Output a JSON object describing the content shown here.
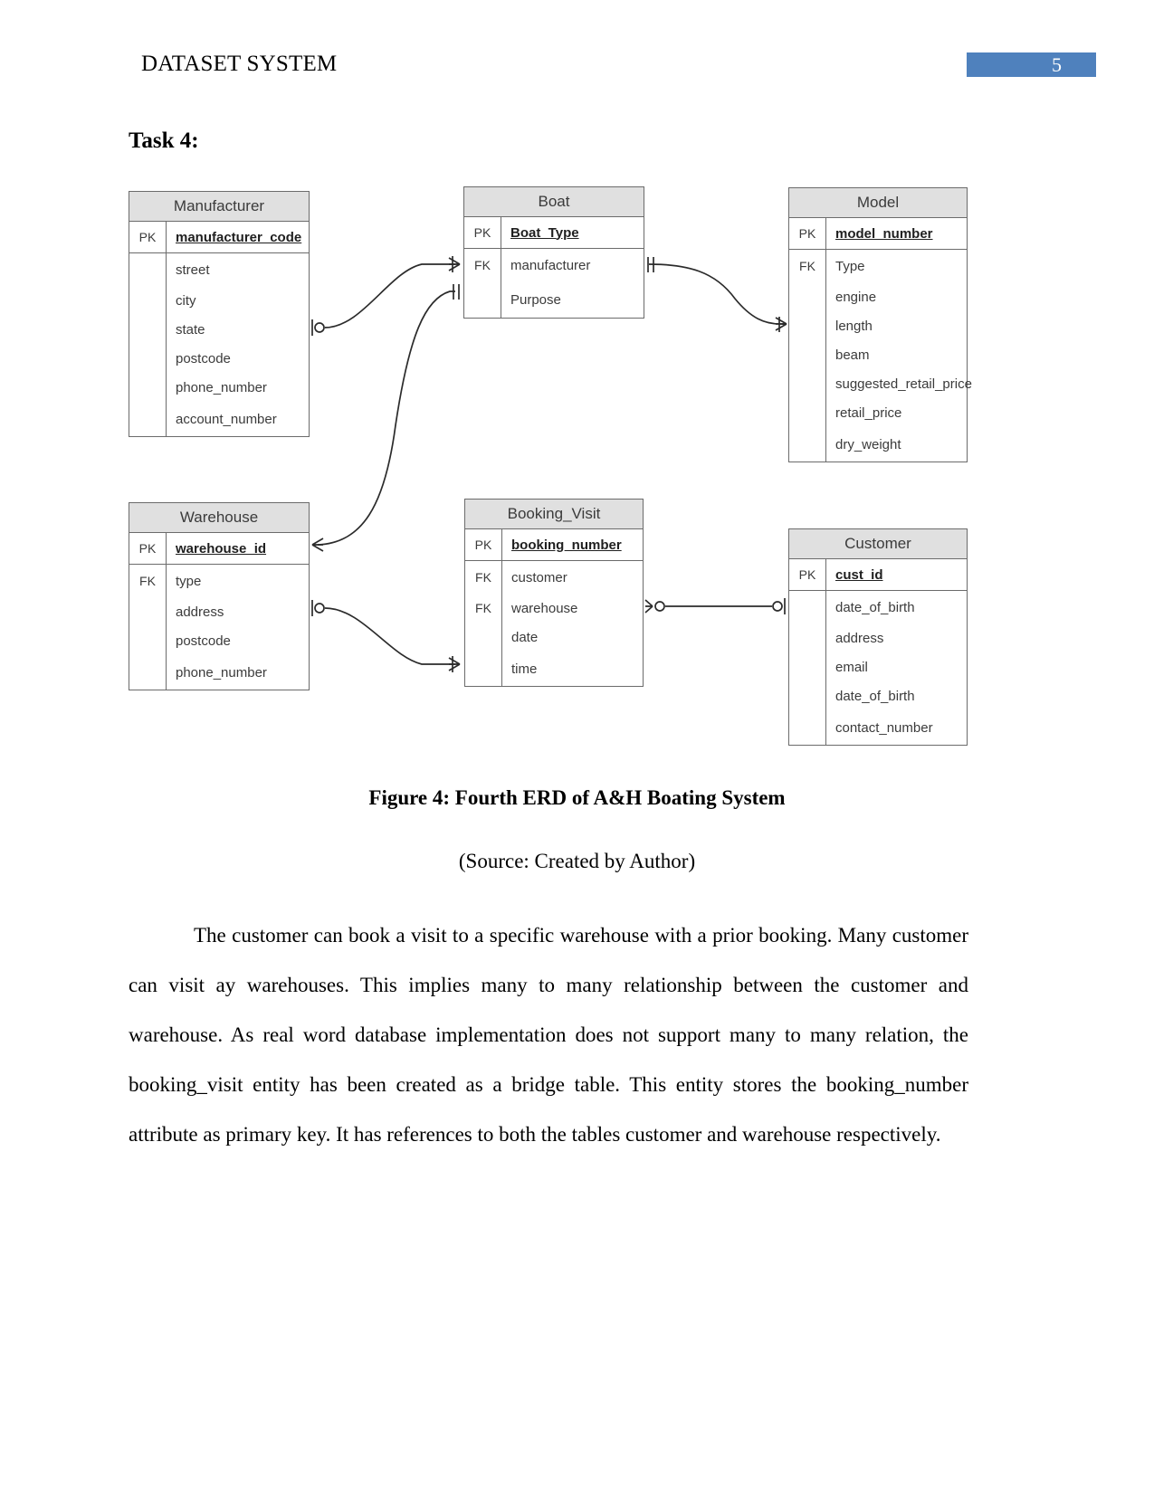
{
  "header": {
    "title": "DATASET SYSTEM",
    "page_number": "5",
    "page_number_box_color": "#4f81bd"
  },
  "heading": {
    "task": "Task 4:"
  },
  "diagram": {
    "key_labels": {
      "pk": "PK",
      "fk": "FK"
    },
    "entities": [
      {
        "id": "manufacturer",
        "name": "Manufacturer",
        "primary_key": {
          "key": "PK",
          "name": "manufacturer_code"
        },
        "attributes": [
          {
            "key": "",
            "name": "street"
          },
          {
            "key": "",
            "name": "city"
          },
          {
            "key": "",
            "name": "state"
          },
          {
            "key": "",
            "name": "postcode"
          },
          {
            "key": "",
            "name": "phone_number"
          },
          {
            "key": "",
            "name": "account_number"
          }
        ]
      },
      {
        "id": "boat",
        "name": "Boat",
        "primary_key": {
          "key": "PK",
          "name": "Boat_Type"
        },
        "attributes": [
          {
            "key": "FK",
            "name": "manufacturer"
          },
          {
            "key": "",
            "name": "Purpose"
          }
        ]
      },
      {
        "id": "model",
        "name": "Model",
        "primary_key": {
          "key": "PK",
          "name": "model_number"
        },
        "attributes": [
          {
            "key": "FK",
            "name": "Type"
          },
          {
            "key": "",
            "name": "engine"
          },
          {
            "key": "",
            "name": "length"
          },
          {
            "key": "",
            "name": "beam"
          },
          {
            "key": "",
            "name": "suggested_retail_price"
          },
          {
            "key": "",
            "name": "retail_price"
          },
          {
            "key": "",
            "name": "dry_weight"
          }
        ]
      },
      {
        "id": "warehouse",
        "name": "Warehouse",
        "primary_key": {
          "key": "PK",
          "name": "warehouse_id"
        },
        "attributes": [
          {
            "key": "FK",
            "name": "type"
          },
          {
            "key": "",
            "name": "address"
          },
          {
            "key": "",
            "name": "postcode"
          },
          {
            "key": "",
            "name": "phone_number"
          }
        ]
      },
      {
        "id": "booking_visit",
        "name": "Booking_Visit",
        "primary_key": {
          "key": "PK",
          "name": "booking_number"
        },
        "attributes": [
          {
            "key": "FK",
            "name": "customer"
          },
          {
            "key": "FK",
            "name": "warehouse"
          },
          {
            "key": "",
            "name": "date"
          },
          {
            "key": "",
            "name": "time"
          }
        ]
      },
      {
        "id": "customer",
        "name": "Customer",
        "primary_key": {
          "key": "PK",
          "name": "cust_id"
        },
        "attributes": [
          {
            "key": "",
            "name": "date_of_birth"
          },
          {
            "key": "",
            "name": "address"
          },
          {
            "key": "",
            "name": "email"
          },
          {
            "key": "",
            "name": "date_of_birth"
          },
          {
            "key": "",
            "name": "contact_number"
          }
        ]
      }
    ],
    "relationships": [
      {
        "from": "manufacturer",
        "to": "boat",
        "from_cardinality": "zero-or-one",
        "to_cardinality": "many"
      },
      {
        "from": "boat",
        "to": "model",
        "from_cardinality": "one-mandatory",
        "to_cardinality": "many"
      },
      {
        "from": "warehouse",
        "to": "boat",
        "from_cardinality": "many",
        "to_cardinality": "one-mandatory"
      },
      {
        "from": "warehouse",
        "to": "booking_visit",
        "from_cardinality": "zero-or-one",
        "to_cardinality": "many"
      },
      {
        "from": "booking_visit",
        "to": "customer",
        "from_cardinality": "zero-or-one",
        "to_cardinality": "one-mandatory"
      }
    ]
  },
  "figure": {
    "caption": "Figure 4: Fourth ERD of A&H Boating System",
    "source": "(Source: Created by Author)"
  },
  "body": {
    "paragraph": "The customer can book a visit to a specific warehouse with a prior booking. Many customer can visit ay warehouses. This implies many to many relationship between the customer and warehouse. As real word database implementation does not support many to many relation, the booking_visit entity has been created as a bridge table. This entity stores the booking_number attribute as primary key. It has references to both the tables customer and warehouse respectively."
  }
}
